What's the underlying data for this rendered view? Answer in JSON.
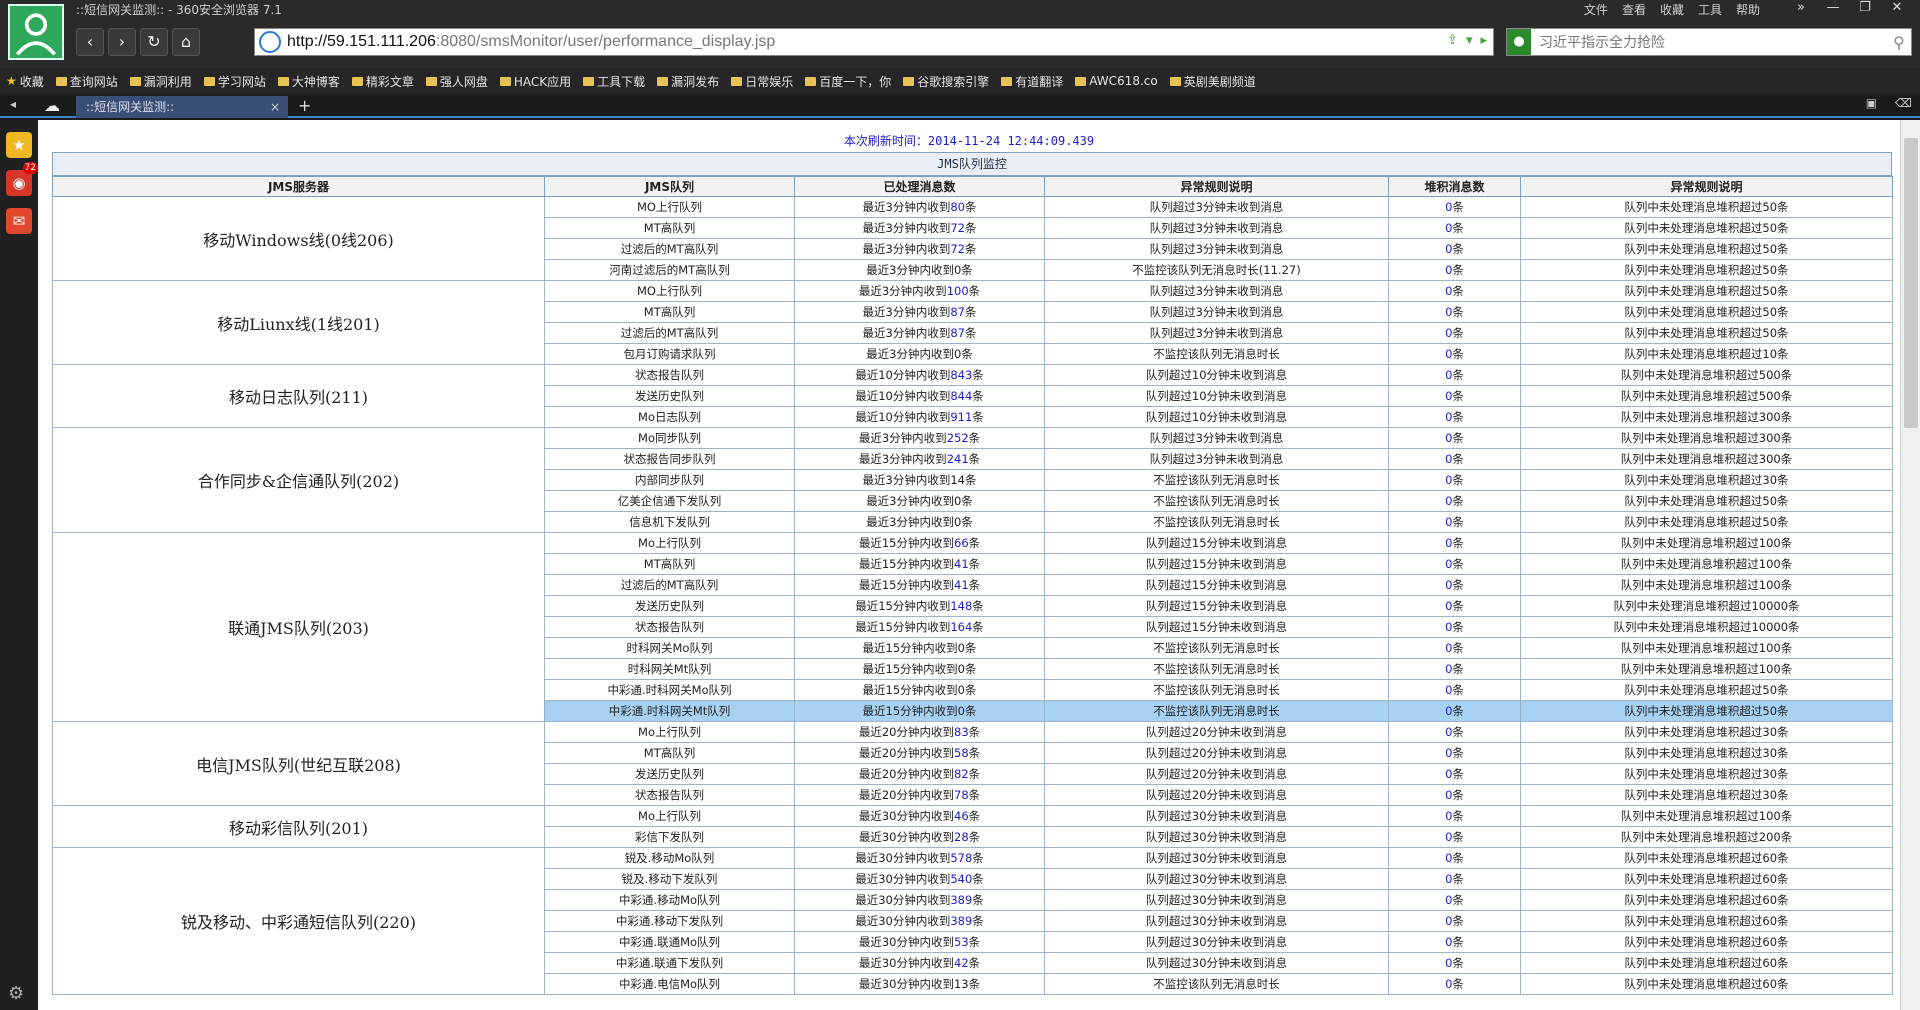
{
  "window": {
    "title": "::短信网关监测:: - 360安全浏览器 7.1",
    "menu": [
      "文件",
      "查看",
      "收藏",
      "工具",
      "帮助"
    ],
    "controls": [
      "»",
      "—",
      "❐",
      "✕"
    ]
  },
  "address": {
    "url_host": "http://59.151.111.206",
    "url_rest": ":8080/smsMonitor/user/performance_display.jsp"
  },
  "search": {
    "placeholder": "习近平指示全力抢险"
  },
  "bookmarks": [
    "收藏",
    "查询网站",
    "漏洞利用",
    "学习网站",
    "大神博客",
    "精彩文章",
    "强人网盘",
    "HACK应用",
    "工具下载",
    "漏洞发布",
    "日常娱乐",
    "百度一下，你",
    "谷歌搜索引擎",
    "有道翻译",
    "AWC618.co",
    "英剧美剧频道"
  ],
  "tab": {
    "label": "::短信网关监测::",
    "close": "×",
    "new": "+"
  },
  "sidebar": {
    "badge": "72"
  },
  "page": {
    "refresh_label": "本次刷新时间：",
    "refresh_time": "2014-11-24 12:44:09.439",
    "table_title": "JMS队列监控",
    "headers": [
      "JMS服务器",
      "JMS队列",
      "已处理消息数",
      "异常规则说明",
      "堆积消息数",
      "异常规则说明"
    ],
    "groups": [
      {
        "name": "移动Windows线(0线206)",
        "rows": [
          [
            "MO上行队列",
            "最近3分钟内收到",
            "80",
            "条",
            "队列超过3分钟未收到消息",
            "0",
            "条",
            "队列中未处理消息堆积超过50条"
          ],
          [
            "MT高队列",
            "最近3分钟内收到",
            "72",
            "条",
            "队列超过3分钟未收到消息",
            "0",
            "条",
            "队列中未处理消息堆积超过50条"
          ],
          [
            "过滤后的MT高队列",
            "最近3分钟内收到",
            "72",
            "条",
            "队列超过3分钟未收到消息",
            "0",
            "条",
            "队列中未处理消息堆积超过50条"
          ],
          [
            "河南过滤后的MT高队列",
            "最近3分钟内收到0条",
            "",
            "",
            "不监控该队列无消息时长(11.27)",
            "0",
            "条",
            "队列中未处理消息堆积超过50条"
          ]
        ]
      },
      {
        "name": "移动Liunx线(1线201)",
        "rows": [
          [
            "MO上行队列",
            "最近3分钟内收到",
            "100",
            "条",
            "队列超过3分钟未收到消息",
            "0",
            "条",
            "队列中未处理消息堆积超过50条"
          ],
          [
            "MT高队列",
            "最近3分钟内收到",
            "87",
            "条",
            "队列超过3分钟未收到消息",
            "0",
            "条",
            "队列中未处理消息堆积超过50条"
          ],
          [
            "过滤后的MT高队列",
            "最近3分钟内收到",
            "87",
            "条",
            "队列超过3分钟未收到消息",
            "0",
            "条",
            "队列中未处理消息堆积超过50条"
          ],
          [
            "包月订购请求队列",
            "最近3分钟内收到0条",
            "",
            "",
            "不监控该队列无消息时长",
            "0",
            "条",
            "队列中未处理消息堆积超过10条"
          ]
        ]
      },
      {
        "name": "移动日志队列(211)",
        "rows": [
          [
            "状态报告队列",
            "最近10分钟内收到",
            "843",
            "条",
            "队列超过10分钟未收到消息",
            "0",
            "条",
            "队列中未处理消息堆积超过500条"
          ],
          [
            "发送历史队列",
            "最近10分钟内收到",
            "844",
            "条",
            "队列超过10分钟未收到消息",
            "0",
            "条",
            "队列中未处理消息堆积超过500条"
          ],
          [
            "Mo日志队列",
            "最近10分钟内收到",
            "911",
            "条",
            "队列超过10分钟未收到消息",
            "0",
            "条",
            "队列中未处理消息堆积超过300条"
          ]
        ]
      },
      {
        "name": "合作同步&企信通队列(202)",
        "rows": [
          [
            "Mo同步队列",
            "最近3分钟内收到",
            "252",
            "条",
            "队列超过3分钟未收到消息",
            "0",
            "条",
            "队列中未处理消息堆积超过300条"
          ],
          [
            "状态报告同步队列",
            "最近3分钟内收到",
            "241",
            "条",
            "队列超过3分钟未收到消息",
            "0",
            "条",
            "队列中未处理消息堆积超过300条"
          ],
          [
            "内部同步队列",
            "最近3分钟内收到14条",
            "",
            "",
            "不监控该队列无消息时长",
            "0",
            "条",
            "队列中未处理消息堆积超过30条"
          ],
          [
            "亿美企信通下发队列",
            "最近3分钟内收到0条",
            "",
            "",
            "不监控该队列无消息时长",
            "0",
            "条",
            "队列中未处理消息堆积超过50条"
          ],
          [
            "信息机下发队列",
            "最近3分钟内收到0条",
            "",
            "",
            "不监控该队列无消息时长",
            "0",
            "条",
            "队列中未处理消息堆积超过50条"
          ]
        ]
      },
      {
        "name": "联通JMS队列(203)",
        "rows": [
          [
            "Mo上行队列",
            "最近15分钟内收到",
            "66",
            "条",
            "队列超过15分钟未收到消息",
            "0",
            "条",
            "队列中未处理消息堆积超过100条"
          ],
          [
            "MT高队列",
            "最近15分钟内收到",
            "41",
            "条",
            "队列超过15分钟未收到消息",
            "0",
            "条",
            "队列中未处理消息堆积超过100条"
          ],
          [
            "过滤后的MT高队列",
            "最近15分钟内收到",
            "41",
            "条",
            "队列超过15分钟未收到消息",
            "0",
            "条",
            "队列中未处理消息堆积超过100条"
          ],
          [
            "发送历史队列",
            "最近15分钟内收到",
            "148",
            "条",
            "队列超过15分钟未收到消息",
            "0",
            "条",
            "队列中未处理消息堆积超过10000条"
          ],
          [
            "状态报告队列",
            "最近15分钟内收到",
            "164",
            "条",
            "队列超过15分钟未收到消息",
            "0",
            "条",
            "队列中未处理消息堆积超过10000条"
          ],
          [
            "时科网关Mo队列",
            "最近15分钟内收到0条",
            "",
            "",
            "不监控该队列无消息时长",
            "0",
            "条",
            "队列中未处理消息堆积超过100条"
          ],
          [
            "时科网关Mt队列",
            "最近15分钟内收到0条",
            "",
            "",
            "不监控该队列无消息时长",
            "0",
            "条",
            "队列中未处理消息堆积超过100条"
          ],
          [
            "中彩通.时科网关Mo队列",
            "最近15分钟内收到0条",
            "",
            "",
            "不监控该队列无消息时长",
            "0",
            "条",
            "队列中未处理消息堆积超过50条"
          ],
          [
            "中彩通.时科网关Mt队列",
            "最近15分钟内收到0条",
            "",
            "",
            "不监控该队列无消息时长",
            "0",
            "条",
            "队列中未处理消息堆积超过50条"
          ]
        ]
      },
      {
        "name": "电信JMS队列(世纪互联208)",
        "rows": [
          [
            "Mo上行队列",
            "最近20分钟内收到",
            "83",
            "条",
            "队列超过20分钟未收到消息",
            "0",
            "条",
            "队列中未处理消息堆积超过30条"
          ],
          [
            "MT高队列",
            "最近20分钟内收到",
            "58",
            "条",
            "队列超过20分钟未收到消息",
            "0",
            "条",
            "队列中未处理消息堆积超过30条"
          ],
          [
            "发送历史队列",
            "最近20分钟内收到",
            "82",
            "条",
            "队列超过20分钟未收到消息",
            "0",
            "条",
            "队列中未处理消息堆积超过30条"
          ],
          [
            "状态报告队列",
            "最近20分钟内收到",
            "78",
            "条",
            "队列超过20分钟未收到消息",
            "0",
            "条",
            "队列中未处理消息堆积超过30条"
          ]
        ]
      },
      {
        "name": "移动彩信队列(201)",
        "rows": [
          [
            "Mo上行队列",
            "最近30分钟内收到",
            "46",
            "条",
            "队列超过30分钟未收到消息",
            "0",
            "条",
            "队列中未处理消息堆积超过100条"
          ],
          [
            "彩信下发队列",
            "最近30分钟内收到",
            "28",
            "条",
            "队列超过30分钟未收到消息",
            "0",
            "条",
            "队列中未处理消息堆积超过200条"
          ]
        ]
      },
      {
        "name": "锐及移动、中彩通短信队列(220)",
        "rows": [
          [
            "锐及.移动Mo队列",
            "最近30分钟内收到",
            "578",
            "条",
            "队列超过30分钟未收到消息",
            "0",
            "条",
            "队列中未处理消息堆积超过60条"
          ],
          [
            "锐及.移动下发队列",
            "最近30分钟内收到",
            "540",
            "条",
            "队列超过30分钟未收到消息",
            "0",
            "条",
            "队列中未处理消息堆积超过60条"
          ],
          [
            "中彩通.移动Mo队列",
            "最近30分钟内收到",
            "389",
            "条",
            "队列超过30分钟未收到消息",
            "0",
            "条",
            "队列中未处理消息堆积超过60条"
          ],
          [
            "中彩通.移动下发队列",
            "最近30分钟内收到",
            "389",
            "条",
            "队列超过30分钟未收到消息",
            "0",
            "条",
            "队列中未处理消息堆积超过60条"
          ],
          [
            "中彩通.联通Mo队列",
            "最近30分钟内收到",
            "53",
            "条",
            "队列超过30分钟未收到消息",
            "0",
            "条",
            "队列中未处理消息堆积超过60条"
          ],
          [
            "中彩通.联通下发队列",
            "最近30分钟内收到",
            "42",
            "条",
            "队列超过30分钟未收到消息",
            "0",
            "条",
            "队列中未处理消息堆积超过60条"
          ],
          [
            "中彩通.电信Mo队列",
            "最近30分钟内收到13条",
            "",
            "",
            "不监控该队列无消息时长",
            "0",
            "条",
            "队列中未处理消息堆积超过60条"
          ]
        ]
      }
    ],
    "highlight_row": "中彩通.时科网关Mt队列"
  }
}
